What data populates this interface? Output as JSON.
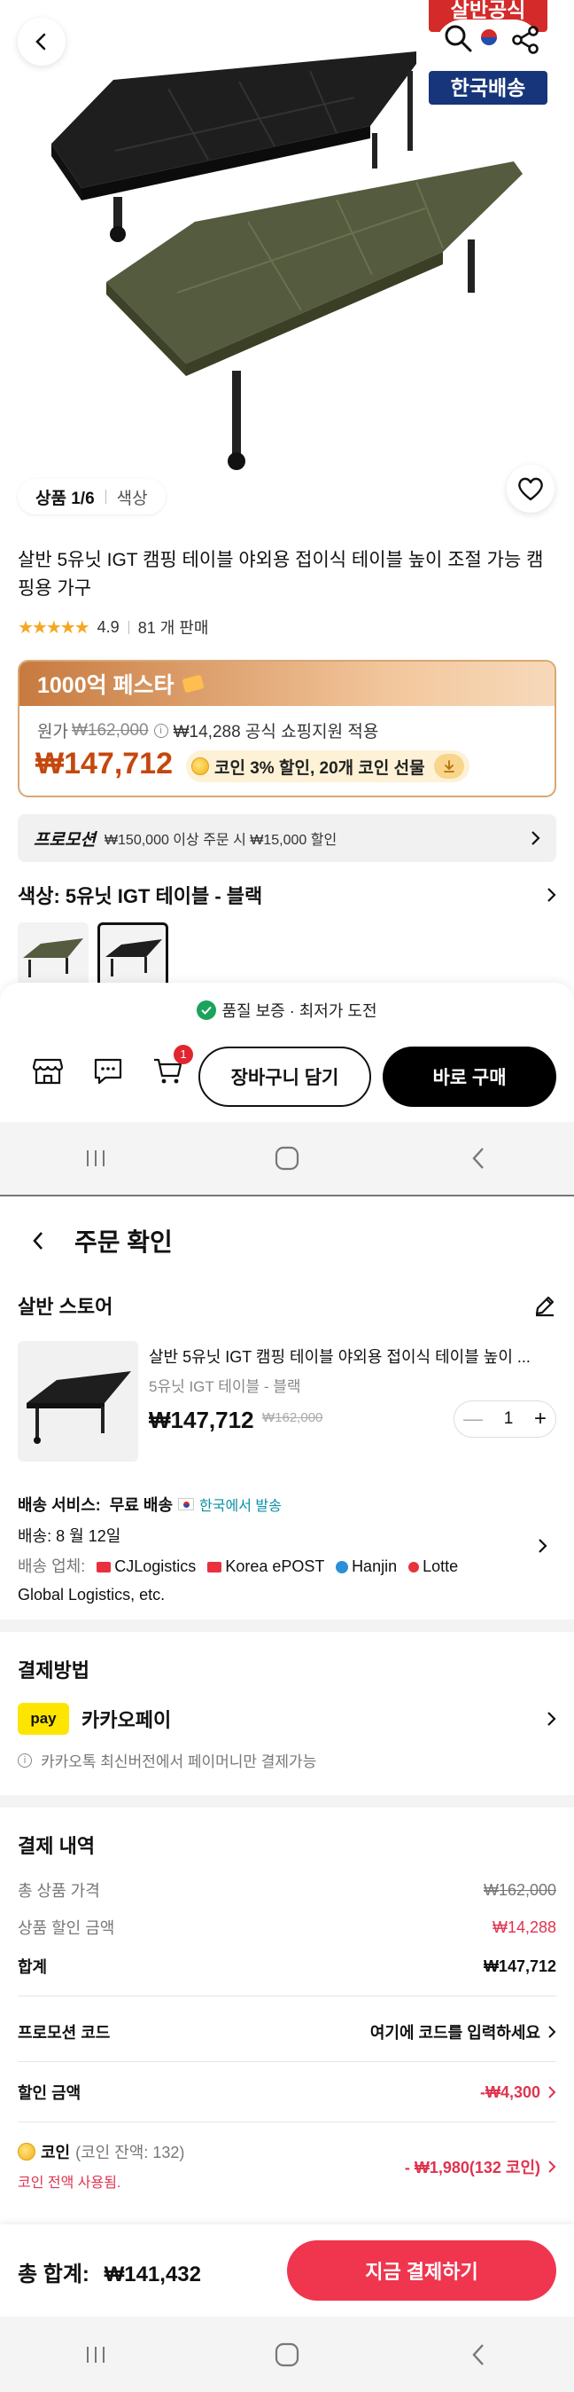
{
  "hero": {
    "seal_top_text": "살반공식",
    "seal_bottom_text": "한국배송",
    "pager_label": "상품 1/6",
    "pager_variant": "색상"
  },
  "product": {
    "title": "살반 5유닛 IGT 캠핑 테이블 야외용 접이식 테이블 높이 조절 가능 캠핑용 가구",
    "rating": "4.9",
    "sold": "81 개 판매",
    "promo_event": "1000억 페스타",
    "original_label": "원가",
    "original_price": "₩162,000",
    "discount_note": "₩14,288 공식 쇼핑지원 적용",
    "sale_price": "₩147,712",
    "coin_offer": "코인 3% 할인,  20개 코인 선물",
    "promotion_label": "프로모션",
    "promotion_text": "₩150,000 이상 주문 시 ₩15,000 할인",
    "color_option": "색상: 5유닛 IGT 테이블 - 블랙"
  },
  "sheet": {
    "guarantee": "품질 보증 · 최저가 도전",
    "cart_badge": "1",
    "add_to_cart": "장바구니 담기",
    "buy_now": "바로 구매"
  },
  "order": {
    "title": "주문 확인",
    "store_name": "살반 스토어",
    "item_name": "살반 5유닛 IGT 캠핑 테이블 야외용 접이식 테이블 높이 ...",
    "item_option": "5유닛 IGT 테이블 - 블랙",
    "item_price": "₩147,712",
    "item_orig": "₩162,000",
    "quantity": "1",
    "shipping_service_label": "배송 서비스:",
    "shipping_service_value": "무료 배송",
    "shipping_origin": "한국에서 발송",
    "delivery_date": "배송: 8 월 12일",
    "carrier_label": "배송 업체:",
    "carriers": [
      "CJLogistics",
      "Korea ePOST",
      "Hanjin",
      "Lotte"
    ],
    "carriers_etc": "Global Logistics, etc."
  },
  "payment": {
    "title": "결제방법",
    "method_logo": "pay",
    "method_name": "카카오페이",
    "note": "카카오톡 최신버전에서 페이머니만 결제가능"
  },
  "summary": {
    "title": "결제 내역",
    "rows": [
      {
        "label": "총 상품 가격",
        "value": "₩162,000"
      },
      {
        "label": "상품 할인 금액",
        "value": "₩14,288"
      },
      {
        "label": "합계",
        "value": "₩147,712"
      }
    ],
    "promo_code_label": "프로모션 코드",
    "promo_code_value": "여기에 코드를 입력하세요",
    "discount_label": "할인 금액",
    "discount_value": "-₩4,300",
    "coin_label": "코인",
    "coin_balance": "(코인 잔액: 132)",
    "coin_used": "코인 전액 사용됨.",
    "coin_value": "- ₩1,980(132 코인)"
  },
  "checkout": {
    "total_label": "총 합계:",
    "total_value": "₩141,432",
    "pay_button": "지금 결제하기"
  },
  "colors": {
    "accent_red": "#f0354f",
    "price_orange": "#c4480e",
    "kakao_yellow": "#fee500"
  }
}
